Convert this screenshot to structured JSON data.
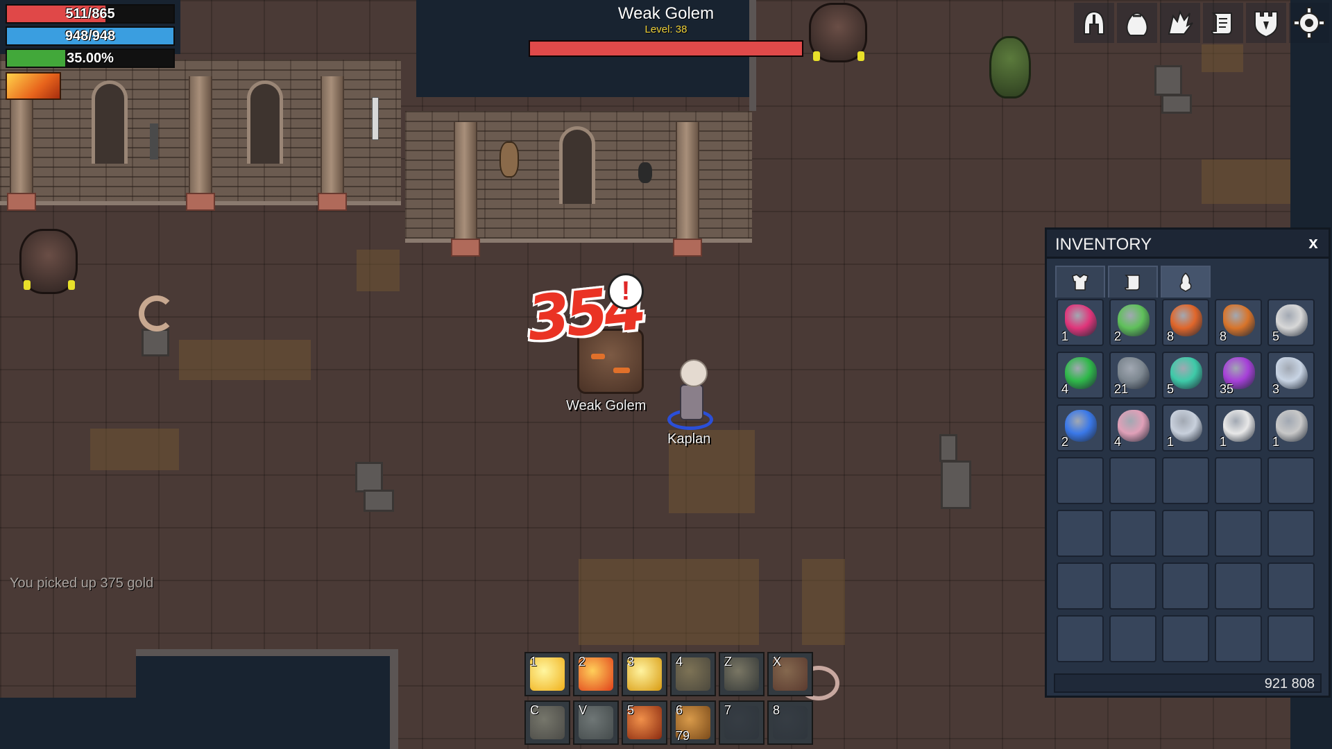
{
  "hud": {
    "hp": {
      "text": "511/865",
      "value": 511,
      "max": 865,
      "color": "#e04848"
    },
    "mp": {
      "text": "948/948",
      "value": 948,
      "max": 948,
      "color": "#3a9ee0"
    },
    "xp": {
      "text": "35.00%",
      "percent": 35.0,
      "color": "#42a83a"
    },
    "buff_icon": "fire-buff-icon"
  },
  "target": {
    "name": "Weak Golem",
    "level_text": "Level: 38",
    "hp_fraction": 1.0,
    "color": "#e04a4a"
  },
  "menu_buttons": [
    {
      "icon": "helmet-icon",
      "label": "Equipment"
    },
    {
      "icon": "bag-icon",
      "label": "Inventory"
    },
    {
      "icon": "wing-icon",
      "label": "Skills"
    },
    {
      "icon": "scroll-icon",
      "label": "Quests"
    },
    {
      "icon": "shield-icon",
      "label": "Guild"
    },
    {
      "icon": "gear-icon",
      "label": "Settings"
    }
  ],
  "world": {
    "boss_name": "Weak Golem",
    "player_name": "Kaplan",
    "damage_number": "354",
    "alert": "!",
    "chat_message": "You picked up 375 gold"
  },
  "inventory": {
    "title": "INVENTORY",
    "close": "x",
    "tabs": [
      {
        "icon": "armor-tab-icon",
        "active": false
      },
      {
        "icon": "scroll-tab-icon",
        "active": false
      },
      {
        "icon": "herb-tab-icon",
        "active": true
      }
    ],
    "slots": [
      {
        "icon": "pink-crystal-icon",
        "count": "1",
        "color": "#e0357a"
      },
      {
        "icon": "green-slime-icon",
        "count": "2",
        "color": "#5fc05a"
      },
      {
        "icon": "mushroom-axe-icon",
        "count": "8",
        "color": "#e0662a"
      },
      {
        "icon": "orange-leaf-icon",
        "count": "8",
        "color": "#d8742a"
      },
      {
        "icon": "white-stone-icon",
        "count": "5",
        "color": "#d8d8d8"
      },
      {
        "icon": "emerald-icon",
        "count": "4",
        "color": "#2fb84a"
      },
      {
        "icon": "grey-rock-icon",
        "count": "21",
        "color": "#7d8790"
      },
      {
        "icon": "teal-ore-icon",
        "count": "5",
        "color": "#3ecaa8"
      },
      {
        "icon": "purple-tentacle-icon",
        "count": "35",
        "color": "#a640d8"
      },
      {
        "icon": "silver-ore-icon",
        "count": "3",
        "color": "#c8d4e4"
      },
      {
        "icon": "blue-ore-icon",
        "count": "2",
        "color": "#3a78e8"
      },
      {
        "icon": "potion-icon",
        "count": "4",
        "color": "#e0a0b8"
      },
      {
        "icon": "claw-icon",
        "count": "1",
        "color": "#c8d0dc"
      },
      {
        "icon": "skull-icon",
        "count": "1",
        "color": "#e8e8e8"
      },
      {
        "icon": "sword-icon",
        "count": "1",
        "color": "#c8c8c8"
      },
      {},
      {},
      {},
      {},
      {},
      {},
      {},
      {},
      {},
      {},
      {},
      {},
      {},
      {},
      {},
      {},
      {},
      {},
      {},
      {}
    ],
    "gold": "921 808"
  },
  "hotbar": {
    "row1": [
      {
        "key": "1",
        "icon": "holy-light-skill-icon",
        "colors": [
          "#fff6a0",
          "#f0b01a"
        ],
        "dim": false
      },
      {
        "key": "2",
        "icon": "fire-swirl-skill-icon",
        "colors": [
          "#ffcf5a",
          "#e0401a"
        ],
        "dim": false
      },
      {
        "key": "3",
        "icon": "crescent-slash-skill-icon",
        "colors": [
          "#fff3a0",
          "#d89a10"
        ],
        "dim": false
      },
      {
        "key": "4",
        "icon": "whirlwind-skill-icon",
        "colors": [
          "#d8b870",
          "#6a5a3a"
        ],
        "dim": true
      },
      {
        "key": "Z",
        "icon": "yin-yang-skill-icon",
        "colors": [
          "#d0c090",
          "#3a3a30"
        ],
        "dim": true
      },
      {
        "key": "X",
        "icon": "flame-burst-skill-icon",
        "colors": [
          "#e8a060",
          "#8a3a1a"
        ],
        "dim": true
      }
    ],
    "row2": [
      {
        "key": "C",
        "icon": "shield-skill-icon",
        "colors": [
          "#c8c0a0",
          "#6a6050"
        ],
        "dim": true,
        "qty": ""
      },
      {
        "key": "V",
        "icon": "blade-skill-icon",
        "colors": [
          "#b8c0b8",
          "#5a605a"
        ],
        "dim": true,
        "qty": ""
      },
      {
        "key": "5",
        "icon": "fire-slash-skill-icon",
        "colors": [
          "#f0904a",
          "#8a2a10"
        ],
        "dim": false,
        "qty": ""
      },
      {
        "key": "6",
        "icon": "bread-item-icon",
        "colors": [
          "#d89a4a",
          "#7a4a1a"
        ],
        "dim": false,
        "qty": "79"
      },
      {
        "key": "7",
        "icon": "empty-slot-icon",
        "colors": [
          "#3a4048",
          "#2a3038"
        ],
        "dim": true,
        "qty": ""
      },
      {
        "key": "8",
        "icon": "empty-slot-icon",
        "colors": [
          "#3a4048",
          "#2a3038"
        ],
        "dim": true,
        "qty": ""
      }
    ]
  }
}
